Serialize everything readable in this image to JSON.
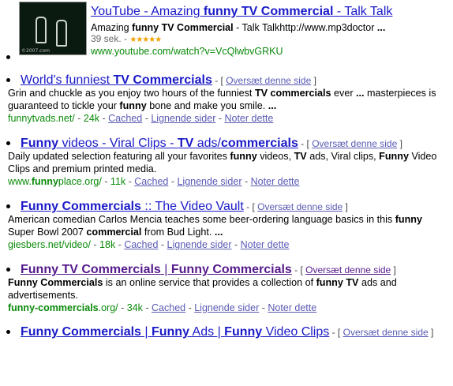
{
  "video_result": {
    "title_pre": "YouTube - Amazing ",
    "title_bold": "funny TV Commercial",
    "title_post": " - Talk Talk",
    "desc_pre": "Amazing ",
    "desc_bold": "funny TV Commercial",
    "desc_post": " - Talk Talkhttp://www.mp3doctor ",
    "desc_ellipsis": "...",
    "duration": "39 sek. - ",
    "stars": "★★★★★",
    "url": "www.youtube.com/watch?v=VcQlwbvGRKU",
    "thumb_tag": "©2007.com"
  },
  "results": [
    {
      "title_parts": [
        {
          "text": "World's funniest ",
          "bold": false
        },
        {
          "text": "TV Commercials",
          "bold": true
        }
      ],
      "translate": "Oversæt denne side",
      "snippet_html_parts": [
        {
          "text": "Grin and chuckle as you enjoy two hours of the funniest ",
          "bold": false
        },
        {
          "text": "TV commercials",
          "bold": true
        },
        {
          "text": " ever ",
          "bold": false
        },
        {
          "text": "...",
          "bold": true
        },
        {
          "text": " masterpieces is guaranteed to tickle your ",
          "bold": false
        },
        {
          "text": "funny",
          "bold": true
        },
        {
          "text": " bone and make you smile. ",
          "bold": false
        },
        {
          "text": "...",
          "bold": true
        }
      ],
      "url_parts": [
        {
          "text": "funnytvads.net/",
          "bold": false
        }
      ],
      "size": "24k",
      "cached": "Cached",
      "similar": "Lignende sider",
      "note": "Noter dette"
    },
    {
      "title_parts": [
        {
          "text": "Funny",
          "bold": true
        },
        {
          "text": " videos - Viral Clips - ",
          "bold": false
        },
        {
          "text": "TV",
          "bold": true
        },
        {
          "text": " ads/",
          "bold": false
        },
        {
          "text": "commercials",
          "bold": true
        }
      ],
      "translate": "Oversæt denne side",
      "snippet_html_parts": [
        {
          "text": "Daily updated selection featuring all your favorites ",
          "bold": false
        },
        {
          "text": "funny",
          "bold": true
        },
        {
          "text": " videos, ",
          "bold": false
        },
        {
          "text": "TV",
          "bold": true
        },
        {
          "text": " ads, Viral clips, ",
          "bold": false
        },
        {
          "text": "Funny",
          "bold": true
        },
        {
          "text": " Video Clips and premium printed media.",
          "bold": false
        }
      ],
      "url_parts": [
        {
          "text": "www.",
          "bold": false
        },
        {
          "text": "funny",
          "bold": true
        },
        {
          "text": "place.org/",
          "bold": false
        }
      ],
      "size": "11k",
      "cached": "Cached",
      "similar": "Lignende sider",
      "note": "Noter dette"
    },
    {
      "title_parts": [
        {
          "text": "Funny Commercials",
          "bold": true
        },
        {
          "text": " :: The Video Vault",
          "bold": false
        }
      ],
      "translate": "Oversæt denne side",
      "snippet_html_parts": [
        {
          "text": "American comedian Carlos Mencia teaches some beer-ordering language basics in this ",
          "bold": false
        },
        {
          "text": "funny",
          "bold": true
        },
        {
          "text": " Super Bowl 2007 ",
          "bold": false
        },
        {
          "text": "commercial",
          "bold": true
        },
        {
          "text": " from Bud Light. ",
          "bold": false
        },
        {
          "text": "...",
          "bold": true
        }
      ],
      "url_parts": [
        {
          "text": "giesbers.net/video/",
          "bold": false
        }
      ],
      "size": "18k",
      "cached": "Cached",
      "similar": "Lignende sider",
      "note": "Noter dette"
    },
    {
      "title_parts": [
        {
          "text": "Funny TV Commercials",
          "bold": true
        },
        {
          "text": " | ",
          "bold": false
        },
        {
          "text": "Funny Commercials",
          "bold": true
        }
      ],
      "visited": true,
      "translate": "Oversæt denne side",
      "snippet_html_parts": [
        {
          "text": "Funny Commercials",
          "bold": true
        },
        {
          "text": " is an online service that provides a collection of ",
          "bold": false
        },
        {
          "text": "funny TV",
          "bold": true
        },
        {
          "text": " ads and advertisements.",
          "bold": false
        }
      ],
      "url_parts": [
        {
          "text": "funny-commercials",
          "bold": true
        },
        {
          "text": ".org/",
          "bold": false
        }
      ],
      "size": "34k",
      "cached": "Cached",
      "similar": "Lignende sider",
      "note": "Noter dette"
    },
    {
      "title_parts": [
        {
          "text": "Funny Commercials",
          "bold": true
        },
        {
          "text": " | ",
          "bold": false
        },
        {
          "text": "Funny",
          "bold": true
        },
        {
          "text": " Ads | ",
          "bold": false
        },
        {
          "text": "Funny",
          "bold": true
        },
        {
          "text": " Video Clips",
          "bold": false
        }
      ],
      "translate": "Oversæt denne side"
    }
  ],
  "colors": {
    "link": "#1a1ac8",
    "visited": "#551a8b",
    "url_green": "#0a8a0a",
    "secondary_link": "#5a5ab4"
  }
}
